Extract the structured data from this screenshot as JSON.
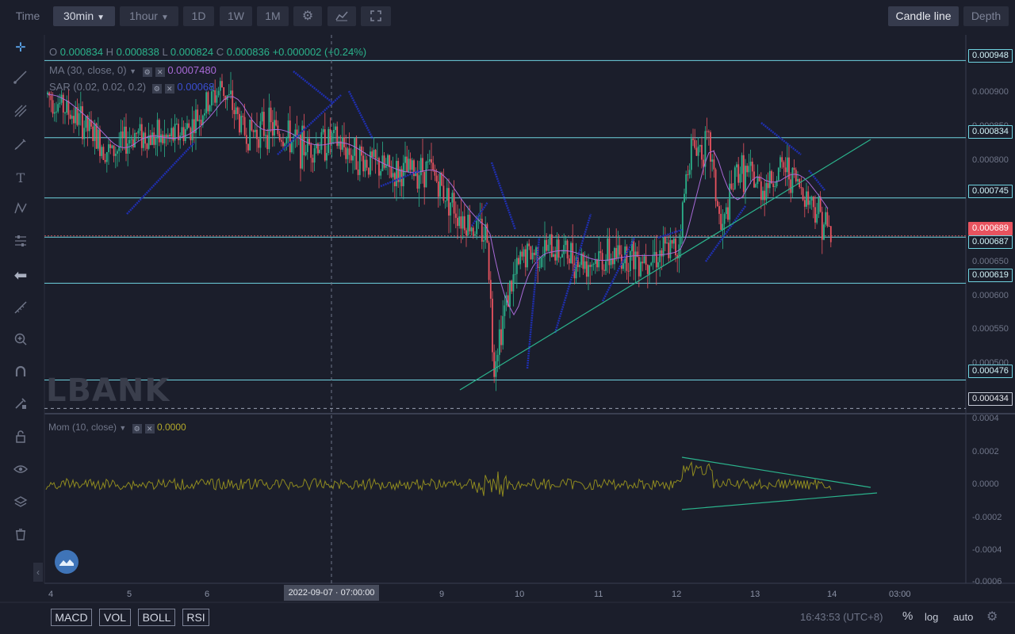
{
  "toolbar": {
    "time_label": "Time",
    "interval_label": "30min",
    "interval_alt_label": "1hour",
    "d1_label": "1D",
    "w1_label": "1W",
    "m1_label": "1M",
    "candle_line_label": "Candle line",
    "depth_label": "Depth",
    "icons": [
      "settings-icon",
      "indicators-icon",
      "fullscreen-icon"
    ]
  },
  "sidebar": {
    "tools": [
      "crosshair-icon",
      "trend-line-icon",
      "fork-icon",
      "brush-icon",
      "text-icon",
      "pattern-icon",
      "measure-icon",
      "back-arrow-icon",
      "ruler-icon",
      "zoom-icon",
      "magnet-icon",
      "lock-drawings-icon",
      "lock-icon",
      "eye-icon",
      "layers-icon",
      "trash-icon"
    ]
  },
  "legend": {
    "ohlc": {
      "o_label": "O",
      "o": "0.000834",
      "h_label": "H",
      "h": "0.000838",
      "l_label": "L",
      "l": "0.000824",
      "c_label": "C",
      "c": "0.000836",
      "change": "+0.000002 (+0.24%)"
    },
    "ma": {
      "label": "MA (30, close, 0)",
      "value": "0.0007480"
    },
    "sar": {
      "label": "SAR (0.02, 0.02, 0.2)",
      "value": "0.00068"
    },
    "mom": {
      "label": "Mom (10, close)",
      "value": "0.0000"
    }
  },
  "price_axis": {
    "ticks": [
      "0.000900",
      "0.000850",
      "0.000800",
      "0.000750",
      "0.000700",
      "0.000650",
      "0.000600",
      "0.000550",
      "0.000500",
      "0.000450"
    ],
    "levels": [
      "0.000948",
      "0.000834",
      "0.000745",
      "0.000687",
      "0.000619",
      "0.000476"
    ],
    "current": "0.000689",
    "dashed": "0.000434"
  },
  "mom_axis": {
    "ticks": [
      "0.0004",
      "0.0002",
      "0.0000",
      "-0.0002",
      "-0.0004",
      "-0.0006"
    ]
  },
  "time_axis": {
    "labels": [
      "4",
      "5",
      "6",
      "9",
      "10",
      "11",
      "12",
      "13",
      "14",
      "03:00"
    ],
    "crosshair_time": "2022-09-07 · 07:00:00"
  },
  "watermark": "LBANK",
  "indicator_buttons": [
    "MACD",
    "VOL",
    "BOLL",
    "RSI"
  ],
  "status": {
    "clock": "16:43:53 (UTC+8)",
    "percent": "%",
    "log": "log",
    "auto": "auto"
  },
  "colors": {
    "up": "#2bb38c",
    "down": "#e8535f",
    "level_line": "#6fd3e0",
    "ma": "#a86ad7",
    "sar": "#1f2fb0",
    "trend": "#2bb38c",
    "mom": "#8f8a1f"
  },
  "chart_data": {
    "type": "candlestick",
    "price_range": [
      0.000434,
      0.00098
    ],
    "horizontal_levels": [
      0.000948,
      0.000834,
      0.000745,
      0.000687,
      0.000619,
      0.000476
    ],
    "current_price": 0.000689,
    "mom_range": [
      -0.0006,
      0.0004
    ]
  }
}
